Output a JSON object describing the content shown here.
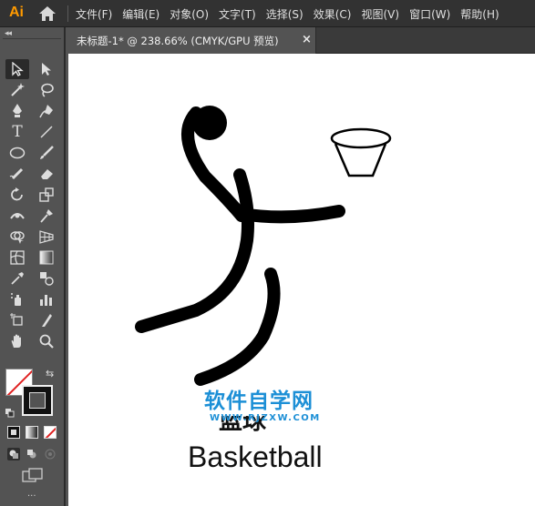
{
  "app": {
    "logo_text": "Ai"
  },
  "menu": {
    "items": [
      {
        "label": "文件(F)"
      },
      {
        "label": "编辑(E)"
      },
      {
        "label": "对象(O)"
      },
      {
        "label": "文字(T)"
      },
      {
        "label": "选择(S)"
      },
      {
        "label": "效果(C)"
      },
      {
        "label": "视图(V)"
      },
      {
        "label": "窗口(W)"
      },
      {
        "label": "帮助(H)"
      }
    ]
  },
  "tab": {
    "title": "未标题-1* @ 238.66% (CMYK/GPU 预览)",
    "close_glyph": "×"
  },
  "toolbar": {
    "collapse_glyph": "◂◂",
    "tools": [
      "selection-tool",
      "direct-selection-tool",
      "magic-wand-tool",
      "lasso-tool",
      "pen-tool",
      "curvature-tool",
      "type-tool",
      "line-segment-tool",
      "ellipse-tool",
      "paintbrush-tool",
      "shaper-tool",
      "eraser-tool",
      "rotate-tool",
      "scale-tool",
      "width-tool",
      "puppet-warp-tool",
      "shape-builder-tool",
      "perspective-grid-tool",
      "mesh-tool",
      "gradient-tool",
      "eyedropper-tool",
      "blend-tool",
      "symbol-sprayer-tool",
      "column-graph-tool",
      "artboard-tool",
      "slice-tool",
      "hand-tool",
      "zoom-tool"
    ]
  },
  "artwork": {
    "label_cn": "篮球",
    "label_en": "Basketball"
  },
  "watermark": {
    "text_cn": "软件自学网",
    "url": "WWW.RJZXW.COM"
  },
  "colors": {
    "ui_dark": "#323232",
    "ui_mid": "#535353",
    "canvas": "#ffffff",
    "logo": "#ff9a00",
    "watermark": "#1c8fd6",
    "stroke_none_red": "#e02020"
  }
}
